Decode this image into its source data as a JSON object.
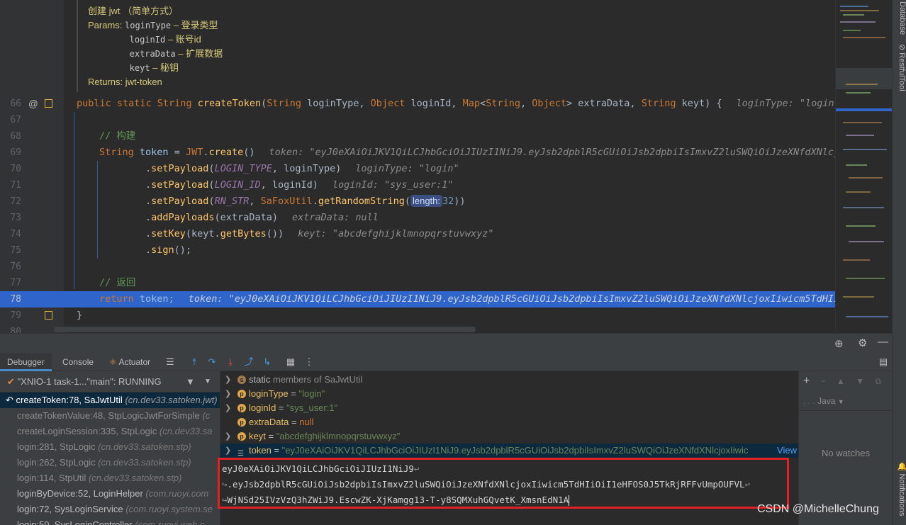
{
  "javadoc": {
    "summary": "创建 jwt （简单方式）",
    "params_label": "Params:",
    "params": [
      {
        "name": "loginType",
        "desc": "– 登录类型"
      },
      {
        "name": "loginId",
        "desc": "– 账号id"
      },
      {
        "name": "extraData",
        "desc": "– 扩展数据"
      },
      {
        "name": "keyt",
        "desc": "– 秘钥"
      }
    ],
    "returns": "Returns: jwt-token"
  },
  "lines": {
    "l66": {
      "num": "66",
      "inlay": "loginType: \"login\""
    },
    "l67": {
      "num": "67"
    },
    "l68": {
      "num": "68",
      "comment": "// 构建"
    },
    "l69": {
      "num": "69",
      "inlay": "token: \"eyJ0eXAiOiJKV1QiLCJhbGciOiJIUzI1NiJ9.eyJsb2dpblR5cGUiOiJsb2dpbiIsImxvZ2luSWQiOiJzeXNfdXNlcjo"
    },
    "l70": {
      "num": "70",
      "inlay": "loginType: \"login\""
    },
    "l71": {
      "num": "71",
      "inlay": "loginId: \"sys_user:1\""
    },
    "l72": {
      "num": "72",
      "hint": "length:"
    },
    "l73": {
      "num": "73",
      "inlay": "extraData: null"
    },
    "l74": {
      "num": "74",
      "inlay": "keyt: \"abcdefghijklmnopqrstuvwxyz\""
    },
    "l75": {
      "num": "75"
    },
    "l76": {
      "num": "76"
    },
    "l77": {
      "num": "77",
      "comment": "// 返回"
    },
    "l78": {
      "num": "78",
      "inlay": "token: \"eyJ0eXAiOiJKV1QiLCJhbGciOiJIUzI1NiJ9.eyJsb2dpblR5cGUiOiJsb2dpbiIsImxvZ2luSWQiOiJzeXNfdXNlcjoxIiwicm5TdHIiO"
    },
    "l79": {
      "num": "79"
    }
  },
  "right_stripe": {
    "database": "Database",
    "restful": "RestfulTool",
    "notifications": "Notifications"
  },
  "debug": {
    "tabs": {
      "debugger": "Debugger",
      "console": "Console",
      "actuator": "Actuator"
    },
    "thread": "\"XNIO-1 task-1...\"main\": RUNNING",
    "frames": [
      {
        "method": "createToken:78, SaJwtUtil",
        "pkg": "(cn.dev33.satoken.jwt)",
        "kind": "current"
      },
      {
        "method": "createTokenValue:48, StpLogicJwtForSimple",
        "pkg": "(c",
        "kind": "lib"
      },
      {
        "method": "createLoginSession:335, StpLogic",
        "pkg": "(cn.dev33.sa",
        "kind": "lib"
      },
      {
        "method": "login:281, StpLogic",
        "pkg": "(cn.dev33.satoken.stp)",
        "kind": "lib"
      },
      {
        "method": "login:262, StpLogic",
        "pkg": "(cn.dev33.satoken.stp)",
        "kind": "lib"
      },
      {
        "method": "login:114, StpUtil",
        "pkg": "(cn.dev33.satoken.stp)",
        "kind": "lib"
      },
      {
        "method": "loginByDevice:52, LoginHelper",
        "pkg": "(com.ruoyi.com",
        "kind": "user"
      },
      {
        "method": "login:72, SysLoginService",
        "pkg": "(com.ruoyi.system.se",
        "kind": "user"
      },
      {
        "method": "login:50, SysLoginController",
        "pkg": "(com.ruoyi.web.c",
        "kind": "user"
      }
    ],
    "variables": {
      "static_row": {
        "prefix": "static",
        "rest": "members of SaJwtUtil"
      },
      "loginType": {
        "name": "loginType",
        "value": "\"login\""
      },
      "loginId": {
        "name": "loginId",
        "value": "\"sys_user:1\""
      },
      "extraData": {
        "name": "extraData",
        "value": "null"
      },
      "keyt": {
        "name": "keyt",
        "value": "\"abcdefghijklmnopqrstuvwxyz\""
      },
      "token": {
        "name": "token",
        "value": "\"eyJ0eXAiOiJKV1QiLCJhbGciOiJIUzI1NiJ9.eyJsb2dpblR5cGUiOiJsb2dpbiIsImxvZ2luSWQiOiJzeXNfdXNlcjoxIiwic",
        "view": "View"
      }
    },
    "token_lines": [
      "eyJ0eXAiOiJKV1QiLCJhbGciOiJIUzI1NiJ9",
      ".eyJsb2dpblR5cGUiOiJsb2dpbiIsImxvZ2luSWQiOiJzeXNfdXNlcjoxIiwicm5TdHIiOiI1eHFOS0J5TkRjRFFvUmpOUFVL",
      "WjNSd25IVzVzQ3hZWiJ9.EscwZK-XjKamgg13-T-y8SQMXuhGQvetK_XmsnEdN1A"
    ],
    "watches": {
      "lang": "Java",
      "empty": "No watches"
    }
  },
  "watermark": "CSDN @MichelleChung",
  "colors": {
    "accent": "#2f65ca",
    "highlight_box": "#e02222",
    "keyword": "#cc7832",
    "string": "#6a8759",
    "comment": "#629755"
  }
}
